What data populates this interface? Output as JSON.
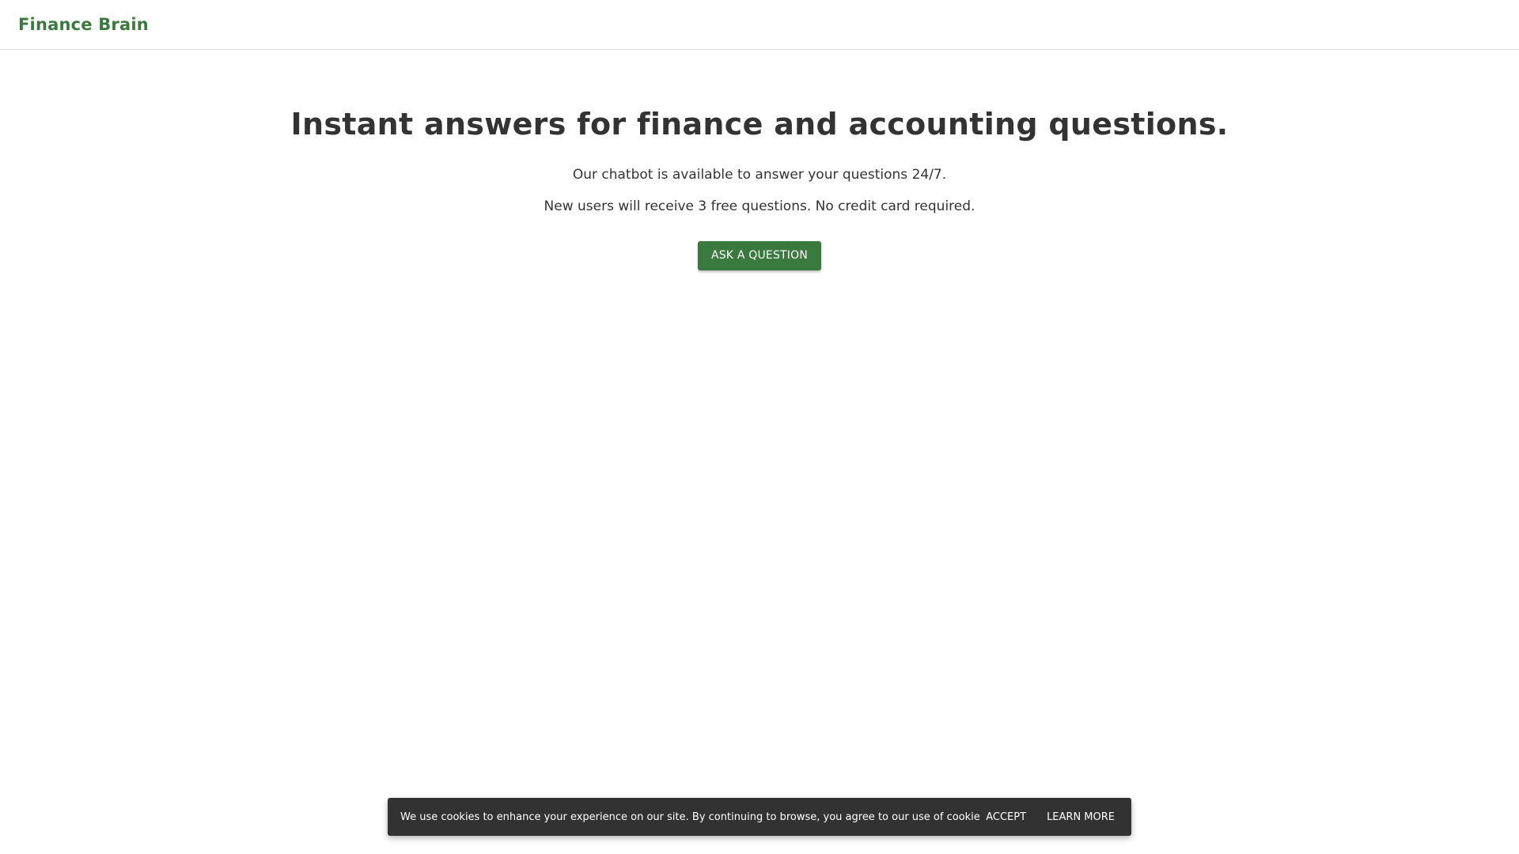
{
  "header": {
    "brand": "Finance Brain",
    "brand_color": "#3a7a3d"
  },
  "hero": {
    "title": "Instant answers for finance and accounting questions.",
    "line1": "Our chatbot is available to answer your questions 24/7.",
    "line2": "New users will receive 3 free questions. No credit card required.",
    "cta_label": "ASK A QUESTION",
    "cta_color": "#3b7a3e"
  },
  "cookie_banner": {
    "text": "We use cookies to enhance your experience on our site. By continuing to browse, you agree to our use of cookies.",
    "accept_label": "ACCEPT",
    "learn_more_label": "LEARN MORE",
    "background": "#323232"
  }
}
